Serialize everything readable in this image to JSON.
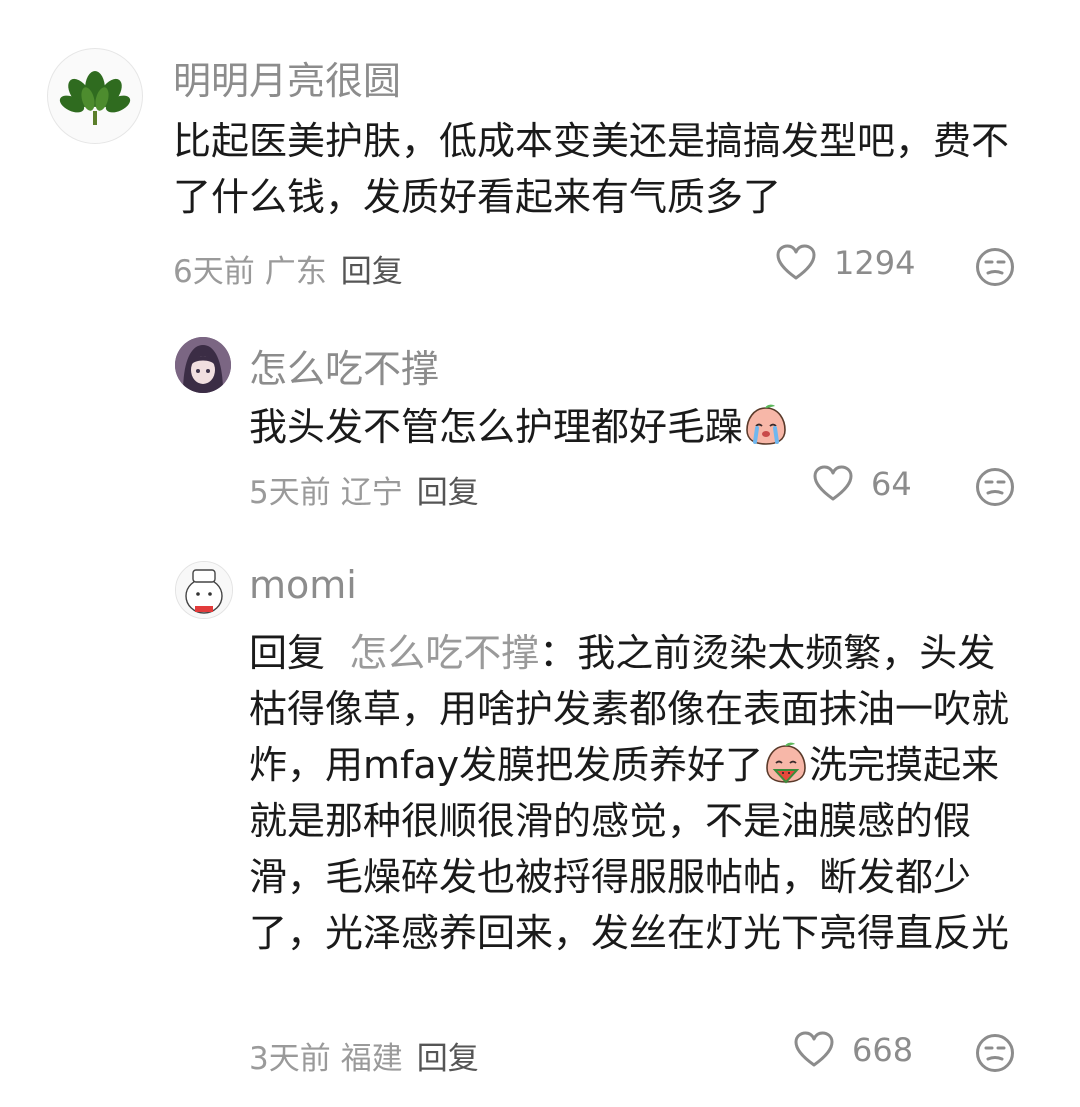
{
  "comments": [
    {
      "name": "明明月亮很圆",
      "text": "比起医美护肤，低成本变美还是搞搞发型吧，费不了什么钱，发质好看起来有气质多了",
      "time": "6天前",
      "location": "广东",
      "reply_label": "回复",
      "likes": "1294"
    },
    {
      "name": "怎么吃不撑",
      "text": "我头发不管怎么护理都好毛躁",
      "time": "5天前",
      "location": "辽宁",
      "reply_label": "回复",
      "likes": "64"
    },
    {
      "name": "momi",
      "reply_prefix": "回复",
      "reply_to": "怎么吃不撑",
      "colon": "：",
      "text_part1": "我之前烫染太频繁，头发枯得像草，用啥护发素都像在表面抹油一吹就炸，用mfay发膜把发质养好了",
      "text_part2": "洗完摸起来就是那种很顺很滑的感觉，不是油膜感的假滑，毛燥碎发也被捋得服服帖帖，断发都少了，光泽感养回来，发丝在灯光下亮得直反光",
      "time": "3天前",
      "location": "福建",
      "reply_label": "回复",
      "likes": "668"
    }
  ],
  "icons": {
    "like": "heart-outline-icon",
    "dislike": "meh-face-icon"
  }
}
